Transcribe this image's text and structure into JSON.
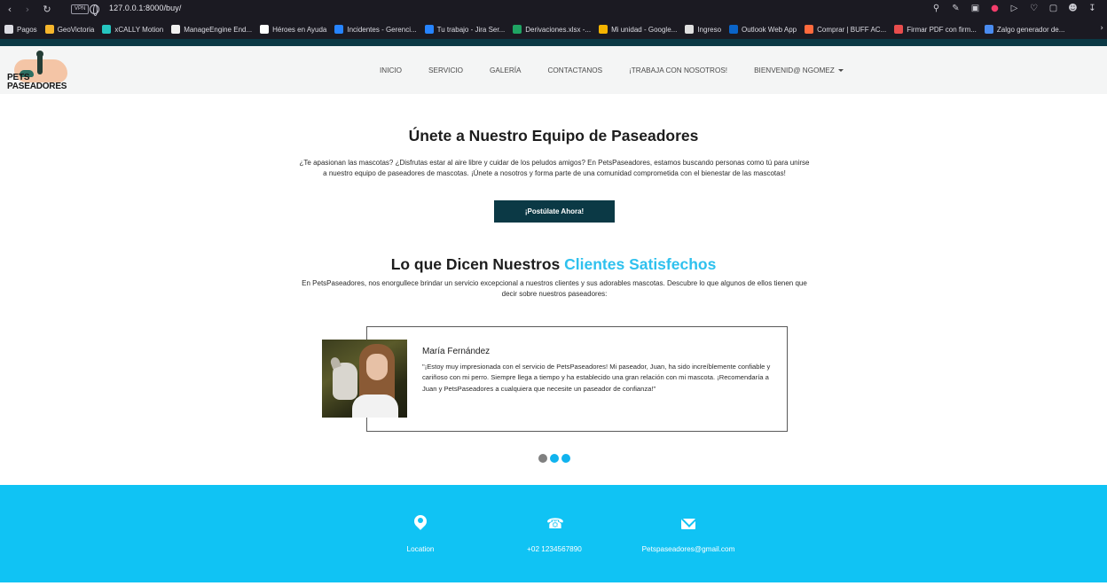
{
  "browser": {
    "url": "127.0.0.1:8000/buy/",
    "vpn_label": "VPN",
    "bookmarks": [
      {
        "label": "Pagos",
        "color": "#dcdce3"
      },
      {
        "label": "GeoVictoria",
        "color": "#f5b62c"
      },
      {
        "label": "xCALLY Motion",
        "color": "#25c6c0"
      },
      {
        "label": "ManageEngine End...",
        "color": "#f0f0f0"
      },
      {
        "label": "Héroes en Ayuda",
        "color": "#ffffff"
      },
      {
        "label": "Incidentes - Gerenci...",
        "color": "#2684ff"
      },
      {
        "label": "Tu trabajo - Jira Ser...",
        "color": "#2684ff"
      },
      {
        "label": "Derivaciones.xlsx -...",
        "color": "#1fa463"
      },
      {
        "label": "Mi unidad - Google...",
        "color": "#f4b400"
      },
      {
        "label": "Ingreso",
        "color": "#e0e0e0"
      },
      {
        "label": "Outlook Web App",
        "color": "#0a64c8"
      },
      {
        "label": "Comprar | BUFF AC...",
        "color": "#ff6a3d"
      },
      {
        "label": "Firmar PDF con firm...",
        "color": "#e94d4d"
      },
      {
        "label": "Zalgo generador de...",
        "color": "#4a8cf0"
      }
    ]
  },
  "logo": {
    "line1": "PETS",
    "line2": "PASEADORES"
  },
  "nav": {
    "items": [
      "INICIO",
      "SERVICIO",
      "GALERÍA",
      "CONTACTANOS",
      "¡TRABAJA CON NOSOTROS!",
      "BIENVENID@ NGOMEZ"
    ]
  },
  "join": {
    "title": "Únete a Nuestro Equipo de Paseadores",
    "text": "¿Te apasionan las mascotas? ¿Disfrutas estar al aire libre y cuidar de los peludos amigos? En PetsPaseadores, estamos buscando personas como tú para unirse a nuestro equipo de paseadores de mascotas. ¡Únete a nosotros y forma parte de una comunidad comprometida con el bienestar de las mascotas!",
    "button": "¡Postúlate Ahora!"
  },
  "testimonials": {
    "title_prefix": "Lo que Dicen Nuestros ",
    "title_highlight": "Clientes Satisfechos",
    "text": "En PetsPaseadores, nos enorgullece brindar un servicio excepcional a nuestros clientes y sus adorables mascotas. Descubre lo que algunos de ellos tienen que decir sobre nuestros paseadores:",
    "name": "María Fernández",
    "review": "\"¡Estoy muy impresionada con el servicio de PetsPaseadores! Mi paseador, Juan, ha sido increíblemente confiable y cariñoso con mi perro. Siempre llega a tiempo y ha establecido una gran relación con mi mascota. ¡Recomendaría a Juan y PetsPaseadores a cualquiera que necesite un paseador de confianza!\"",
    "dot_colors": [
      "#808080",
      "#10b3ee",
      "#10b3ee"
    ]
  },
  "footer": {
    "location": "Location",
    "phone": "+02 1234567890",
    "email": "Petspaseadores@gmail.com"
  },
  "colors": {
    "primary_dark": "#0b3945",
    "accent": "#10c3f4",
    "highlight": "#2fc1ee"
  }
}
